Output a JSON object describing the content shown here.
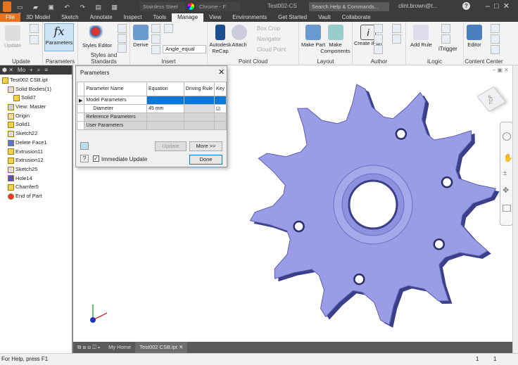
{
  "titlebar": {
    "material": "Stainless Steel",
    "appearance": "Chrome - F",
    "doc_title": "Test002-CS",
    "search_placeholder": "Search Help & Commands...",
    "user": "clint.brown@t...",
    "help": "?"
  },
  "tabs": [
    "File",
    "3D Model",
    "Sketch",
    "Annotate",
    "Inspect",
    "Tools",
    "Manage",
    "View",
    "Environments",
    "Get Started",
    "Vault",
    "Collaborate"
  ],
  "active_tab": "Manage",
  "ribbon": {
    "update": {
      "button": "Update",
      "label": "Update"
    },
    "parameters": {
      "button": "Parameters",
      "label": "Parameters",
      "glyph": "fx"
    },
    "styles": {
      "button": "Styles Editor",
      "label": "Styles and Standards"
    },
    "insert": {
      "derive": "Derive",
      "dropdown": "Angle_equal",
      "label": "Insert"
    },
    "pointcloud": {
      "recap": "Autodesk ReCap",
      "attach": "Attach",
      "box_crop": "Box Crop",
      "navigator": "Navigator",
      "cloud_point": "Cloud Point",
      "label": "Point Cloud"
    },
    "layout": {
      "make_part": "Make Part",
      "make_components": "Make Components",
      "label": "Layout"
    },
    "author": {
      "create_ipart": "Create iPart",
      "label": "Author"
    },
    "ilogic": {
      "add_rule": "Add Rule",
      "trigger": "iTrigger",
      "label": "iLogic"
    },
    "content": {
      "editor": "Editor",
      "label": "Content Center"
    }
  },
  "browser": {
    "tab": "Mo",
    "items": [
      {
        "label": "Test002 CSB.ipt"
      },
      {
        "label": "Solid Bodies(1)"
      },
      {
        "label": "Solid7"
      },
      {
        "label": "View: Master"
      },
      {
        "label": "Origin"
      },
      {
        "label": "Solid1"
      },
      {
        "label": "Sketch22"
      },
      {
        "label": "Delete Face1"
      },
      {
        "label": "Extrusion11"
      },
      {
        "label": "Extrusion12"
      },
      {
        "label": "Sketch25"
      },
      {
        "label": "Hole14"
      },
      {
        "label": "Chamfer5"
      },
      {
        "label": "End of Part"
      }
    ]
  },
  "dialog": {
    "title": "Parameters",
    "columns": [
      "Parameter Name",
      "Equation",
      "Driving Rule",
      "Key"
    ],
    "rows": [
      {
        "name": "Model Parameters",
        "equation": ""
      },
      {
        "name": "Diameter",
        "equation": "45 mm"
      },
      {
        "name": "Reference Parameters",
        "equation": ""
      },
      {
        "name": "User Parameters",
        "equation": ""
      }
    ],
    "update": "Update",
    "more": "More >>",
    "immediate_update": "Immediate Update",
    "done": "Done"
  },
  "viewcube": {
    "face": "TOP"
  },
  "doctabs": {
    "home": "My Home",
    "doc": "Test002 CSB.ipt"
  },
  "status": {
    "help": "For Help, press F1",
    "count1": "1",
    "count2": "1"
  },
  "colors": {
    "accent": "#e8731f",
    "model": "#9a9de6"
  }
}
